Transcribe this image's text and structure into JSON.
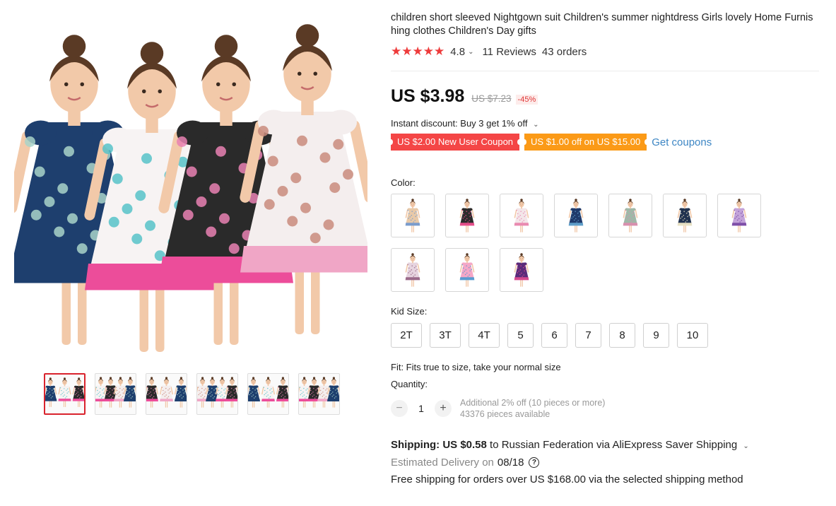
{
  "product": {
    "title": "children short sleeved Nightgown suit Children's summer nightdress Girls lovely Home Furnishing clothes Children's Day gifts",
    "rating_stars": "★★★★★",
    "rating_value": "4.8",
    "reviews": "11 Reviews",
    "orders": "43 orders"
  },
  "price": {
    "current": "US $3.98",
    "original": "US $7.23",
    "discount": "-45%"
  },
  "promo": {
    "instant_discount": "Instant discount: Buy 3 get 1% off",
    "coupon_new_user": "US $2.00 New User Coupon",
    "coupon_spend": "US $1.00 off on US $15.00",
    "get_coupons": "Get coupons"
  },
  "color": {
    "label": "Color:",
    "options": [
      {
        "dress": "#e8c9a8",
        "accent": "#7a9ccc"
      },
      {
        "dress": "#2b2b2b",
        "accent": "#e44e8a"
      },
      {
        "dress": "#f3e6e9",
        "accent": "#e98ab0"
      },
      {
        "dress": "#1f3a6b",
        "accent": "#5f9ec9"
      },
      {
        "dress": "#9fb8a8",
        "accent": "#d88fae"
      },
      {
        "dress": "#21324f",
        "accent": "#e7e0c3"
      },
      {
        "dress": "#c3a3d9",
        "accent": "#7e4fa8"
      },
      {
        "dress": "#e6d4df",
        "accent": "#9b6a8a"
      },
      {
        "dress": "#f5a7c7",
        "accent": "#5a9bd0"
      },
      {
        "dress": "#5a2b7a",
        "accent": "#d64a8f"
      }
    ]
  },
  "size": {
    "label": "Kid Size:",
    "options": [
      "2T",
      "3T",
      "4T",
      "5",
      "6",
      "7",
      "8",
      "9",
      "10"
    ]
  },
  "fit": "Fit: Fits true to size, take your normal size",
  "quantity": {
    "label": "Quantity:",
    "minus": "−",
    "value": "1",
    "plus": "+",
    "additional": "Additional 2% off (10 pieces or more)",
    "available": "43376 pieces available"
  },
  "shipping": {
    "label": "Shipping: US $0.58",
    "detail": " to Russian Federation via AliExpress Saver Shipping",
    "estimated_label": "Estimated Delivery on",
    "estimated_date": "08/18",
    "help_glyph": "?",
    "free": "Free shipping for orders over US $168.00 via the selected shipping method"
  },
  "gallery": {
    "thumb_count": 6,
    "dresses": [
      {
        "body": "#1e3f6e",
        "pattern": "#a9d4c9",
        "hem": "#1e3f6e"
      },
      {
        "body": "#f7f3f3",
        "pattern": "#57c2c8",
        "hem": "#ec4d9a"
      },
      {
        "body": "#2a2a2a",
        "pattern": "#e981b3",
        "hem": "#ec4d9a"
      },
      {
        "body": "#f4eeee",
        "pattern": "#c98b7c",
        "hem": "#f0a6c6"
      }
    ],
    "skin": "#f2c9a9",
    "hair": "#5a3a25"
  },
  "icons": {
    "chevron": "chevron-down-icon",
    "help": "question-circle-icon"
  }
}
